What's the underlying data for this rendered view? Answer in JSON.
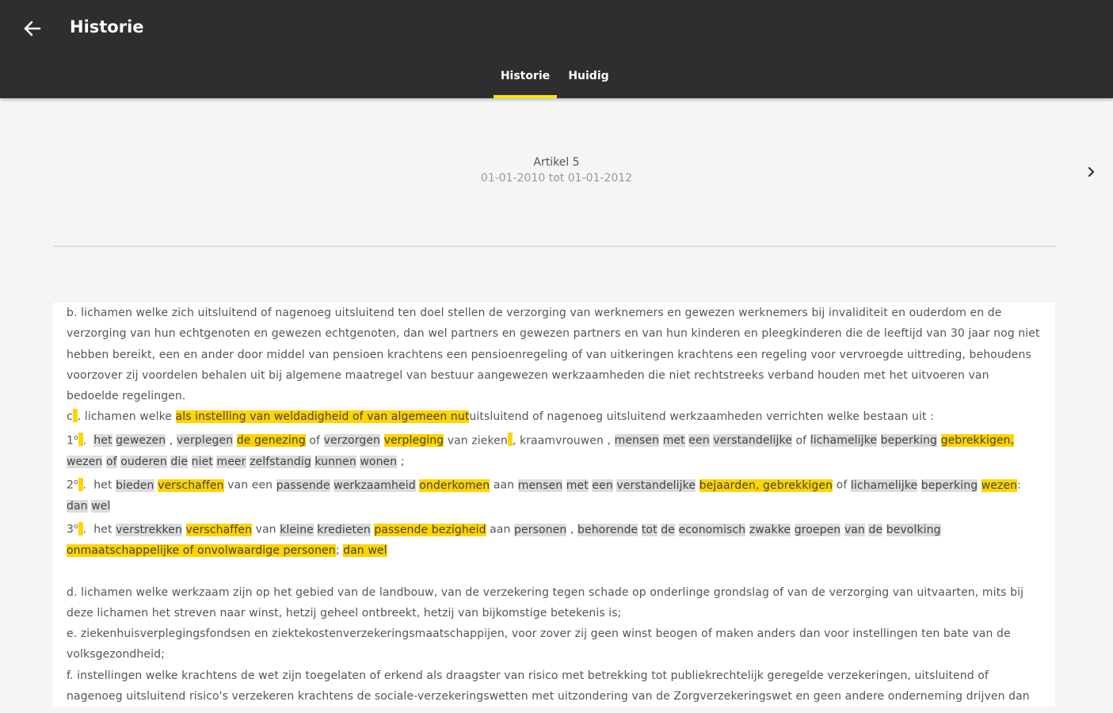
{
  "appbar": {
    "title": "Historie",
    "back_icon": "arrow-back-icon"
  },
  "tabs": [
    {
      "label": "Historie",
      "active": true
    },
    {
      "label": "Huidig",
      "active": false
    }
  ],
  "article": {
    "title": "Artikel 5",
    "period": "01-01-2010 tot 01-01-2012",
    "next_icon": "chevron-right-icon"
  },
  "colors": {
    "appbar": "#2e2e2e",
    "accent": "#ffe600",
    "highlight_added": "#ffd400",
    "highlight_removed": "#dcdcdc"
  },
  "body": {
    "b": "b.  lichamen welke zich uitsluitend of nagenoeg uitsluitend ten doel stellen de verzorging van werknemers en gewezen werknemers bij invaliditeit en ouderdom en de verzorging van hun echtgenoten en gewezen echtgenoten, dan wel partners en gewezen partners en van hun kinderen en pleegkinderen die de leeftijd van 30 jaar nog niet hebben bereikt, een en ander door middel van pensioen krachtens een pensioenregeling of van uitkeringen krachtens een regeling voor vervroegde uittreding, behoudens voorzover zij voordelen behalen uit bij algemene maatregel van bestuur aangewezen werkzaamheden die niet rechtstreeks verband houden met het uitvoeren van bedoelde regelingen.",
    "c": {
      "prefix": "c",
      "p1": ".  lichamen welke ",
      "y1": "als instelling van weldadigheid of van algemeen nut",
      "p2": "uitsluitend of nagenoeg uitsluitend werkzaamheden verrichten welke bestaan uit :"
    },
    "c1": {
      "num": "1",
      "sup": "o",
      "t": [
        "het",
        "gewezen",
        "verplegen",
        "de genezing",
        "of",
        "verzorgen",
        "verpleging",
        "van zieken",
        ", kraamvrouwen",
        "mensen",
        "met",
        "een",
        "verstandelijke",
        "of",
        "lichamelijke",
        "beperking",
        "gebrekkigen,",
        "wezen",
        "of",
        "ouderen",
        "die",
        "niet",
        "meer",
        "zelfstandig",
        "kunnen",
        "wonen",
        ";"
      ]
    },
    "c2": {
      "num": "2",
      "sup": "o",
      "t": [
        "het",
        "bieden",
        "verschaffen",
        "van een",
        "passende",
        "werkzaamheid",
        "onderkomen",
        "aan",
        "mensen",
        "met",
        "een",
        "verstandelijke",
        "bejaarden, gebrekkigen",
        "of",
        "lichamelijke",
        "beperking",
        "wezen",
        ":",
        "dan",
        "wel"
      ]
    },
    "c3": {
      "num": "3",
      "sup": "o",
      "t": [
        "het",
        "verstrekken",
        "verschaffen",
        "van",
        "kleine",
        "kredieten",
        "passende bezigheid",
        "aan",
        "personen",
        ",",
        "behorende",
        "tot",
        "de",
        "economisch",
        "zwakke",
        "groepen",
        "van",
        "de",
        "bevolking",
        "onmaatschappelijke of onvolwaardige personen",
        ";",
        "dan wel"
      ]
    },
    "d": "d.  lichamen welke werkzaam zijn op het gebied van de landbouw, van de verzekering tegen schade op onderlinge grondslag of van de verzorging van uitvaarten, mits bij deze lichamen het streven naar winst, hetzij geheel ontbreekt, hetzij van bijkomstige betekenis is;",
    "e": "e.  ziekenhuisverplegingsfondsen en ziektekostenverzekeringsmaatschappijen, voor zover zij geen winst beogen of maken anders dan voor instellingen ten bate van de volksgezondheid;",
    "f": "f.  instellingen welke krachtens de wet zijn toegelaten of erkend als draagster van risico met betrekking tot publiekrechtelijk geregelde verzekeringen, uitsluitend of nagenoeg uitsluitend risico's verzekeren krachtens de sociale-verzekeringswetten met uitzondering van de Zorgverzekeringswet en geen andere onderneming drijven dan een verzekeringsonderneming;"
  }
}
